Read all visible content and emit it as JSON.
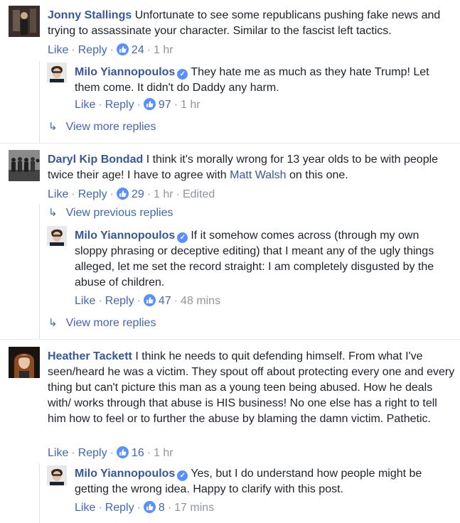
{
  "comments": [
    {
      "author": "Jonny Stallings",
      "text": "Unfortunate to see some republicans pushing fake news and trying to assassinate your character. Similar to the fascist left tactics.",
      "actions": {
        "like": "Like",
        "reply": "Reply",
        "likes": "24",
        "time": "1 hr"
      },
      "reply": {
        "author": "Milo Yiannopoulos",
        "text": "They hate me as much as they hate Trump! Let them come. It didn't do Daddy any harm.",
        "actions": {
          "like": "Like",
          "reply": "Reply",
          "likes": "97",
          "time": "1 hr"
        }
      },
      "more_replies": "View more replies"
    },
    {
      "author": "Daryl Kip Bondad",
      "text_before": "I think it's morally wrong for 13 year olds to be with people twice their age! I have to agree with",
      "mention": "Matt Walsh",
      "text_after": "on this one.",
      "actions": {
        "like": "Like",
        "reply": "Reply",
        "likes": "29",
        "time": "1 hr",
        "edited": "Edited"
      },
      "previous_replies": "View previous replies",
      "reply": {
        "author": "Milo Yiannopoulos",
        "text": "If it somehow comes across (through my own sloppy phrasing or deceptive editing) that I meant any of the ugly things alleged, let me set the record straight: I am completely disgusted by the abuse of children.",
        "actions": {
          "like": "Like",
          "reply": "Reply",
          "likes": "47",
          "time": "48 mins"
        }
      },
      "more_replies": "View more replies"
    },
    {
      "author": "Heather Tackett",
      "text": "I think he needs to quit defending himself. From what I've seen/heard he was a victim. They spout off about protecting every one and every thing but can't picture this man as a young teen being abused. How he deals with/ works through that abuse is HIS business! No one else has a right to tell him how to feel or to further the abuse by blaming the damn victim. Pathetic.",
      "actions": {
        "like": "Like",
        "reply": "Reply",
        "likes": "16",
        "time": "1 hr"
      },
      "reply": {
        "author": "Milo Yiannopoulos",
        "text": "Yes, but I do understand how people might be getting the wrong idea. Happy to clarify with this post.",
        "actions": {
          "like": "Like",
          "reply": "Reply",
          "likes": "8",
          "time": "17 mins"
        }
      }
    }
  ],
  "icons": {
    "like": "thumbs-up-icon",
    "verified": "verified-check-icon",
    "reply_arrow": "reply-arrow-icon"
  },
  "colors": {
    "link": "#365899",
    "action": "#4267b2",
    "meta": "#90949c",
    "like_badge": "#5890ff"
  }
}
